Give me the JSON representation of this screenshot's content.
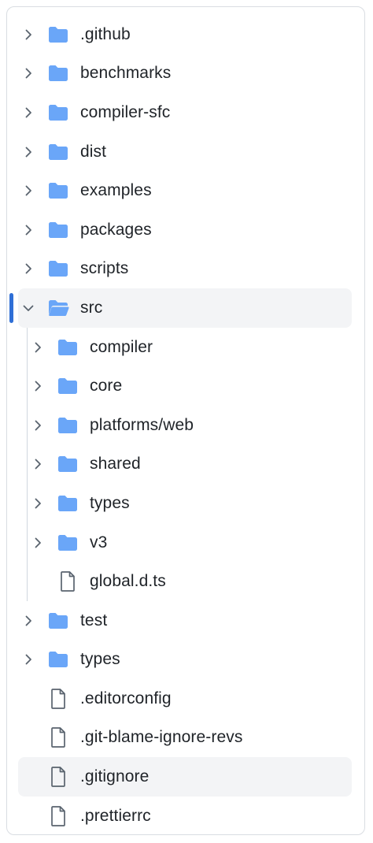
{
  "tree": {
    "folder_color": "#6aa6f8",
    "file_color": "#59636e",
    "active_indicator_color": "#2f6fd6",
    "before": [
      {
        "label": ".github",
        "type": "folder",
        "expanded": false
      },
      {
        "label": "benchmarks",
        "type": "folder",
        "expanded": false
      },
      {
        "label": "compiler-sfc",
        "type": "folder",
        "expanded": false
      },
      {
        "label": "dist",
        "type": "folder",
        "expanded": false
      },
      {
        "label": "examples",
        "type": "folder",
        "expanded": false
      },
      {
        "label": "packages",
        "type": "folder",
        "expanded": false
      },
      {
        "label": "scripts",
        "type": "folder",
        "expanded": false
      }
    ],
    "src": {
      "label": "src",
      "type": "folder",
      "expanded": true
    },
    "src_children": [
      {
        "label": "compiler",
        "type": "folder",
        "expanded": false
      },
      {
        "label": "core",
        "type": "folder",
        "expanded": false
      },
      {
        "label": "platforms/web",
        "type": "folder",
        "expanded": false
      },
      {
        "label": "shared",
        "type": "folder",
        "expanded": false
      },
      {
        "label": "types",
        "type": "folder",
        "expanded": false
      },
      {
        "label": "v3",
        "type": "folder",
        "expanded": false
      },
      {
        "label": "global.d.ts",
        "type": "file"
      }
    ],
    "after": [
      {
        "label": "test",
        "type": "folder",
        "expanded": false
      },
      {
        "label": "types",
        "type": "folder",
        "expanded": false
      },
      {
        "label": ".editorconfig",
        "type": "file"
      },
      {
        "label": ".git-blame-ignore-revs",
        "type": "file"
      },
      {
        "label": ".gitignore",
        "type": "file",
        "hovered": true
      },
      {
        "label": ".prettierrc",
        "type": "file"
      }
    ]
  }
}
